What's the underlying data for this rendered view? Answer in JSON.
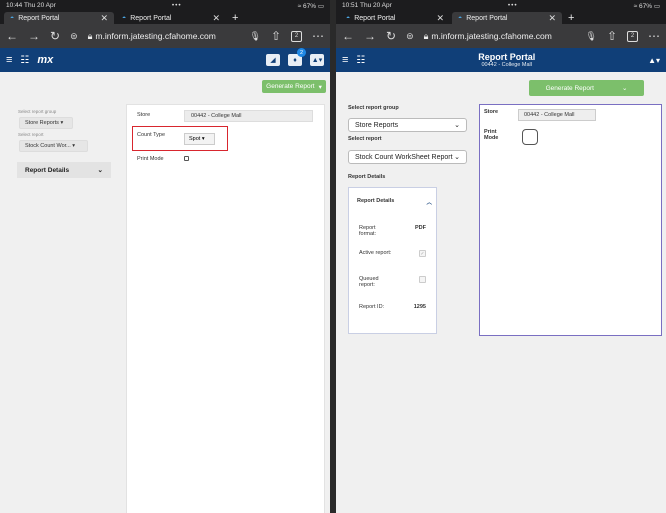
{
  "left": {
    "status": {
      "time": "10:44",
      "date": "Thu 20 Apr",
      "battery": "67%"
    },
    "tabs": [
      {
        "label": "Report Portal",
        "active": true
      },
      {
        "label": "Report Portal",
        "active": false
      }
    ],
    "url": "m.inform.jatesting.cfahome.com",
    "tab_count": "2",
    "badge": "2",
    "generate_label": "Generate Report",
    "select_group_label": "Select report group",
    "group_value": "Store Reports",
    "select_report_label": "Select report",
    "report_value": "Stock Count Wor...",
    "report_details": "Report Details",
    "store_label": "Store",
    "store_value": "00442 - College Mall",
    "count_type_label": "Count Type",
    "count_type_value": "Spot",
    "print_mode_label": "Print Mode"
  },
  "right": {
    "status": {
      "time": "10:51",
      "date": "Thu 20 Apr",
      "battery": "67%"
    },
    "tabs": [
      {
        "label": "Report Portal",
        "active": false
      },
      {
        "label": "Report Portal",
        "active": true
      }
    ],
    "url": "m.inform.jatesting.cfahome.com",
    "tab_count": "2",
    "app_title": "Report Portal",
    "app_subtitle": "00442 - College Mall",
    "generate_label": "Generate Report",
    "select_group_label": "Select report group",
    "group_value": "Store Reports",
    "select_report_label": "Select report",
    "report_value": "Stock Count WorkSheet Report",
    "report_details_heading": "Report Details",
    "report_details_panel": "Report Details",
    "rows": [
      {
        "label": "Report format:",
        "value": "PDF"
      },
      {
        "label": "Active report:",
        "value": ""
      },
      {
        "label": "Queued report:",
        "value": ""
      },
      {
        "label": "Report ID:",
        "value": "1295"
      }
    ],
    "store_label": "Store",
    "store_value": "00442 - College Mall",
    "print_mode_label": "Print Mode"
  },
  "colors": {
    "header": "#103f78",
    "generate": "#7cbf6b",
    "highlight": "#d8262e"
  }
}
